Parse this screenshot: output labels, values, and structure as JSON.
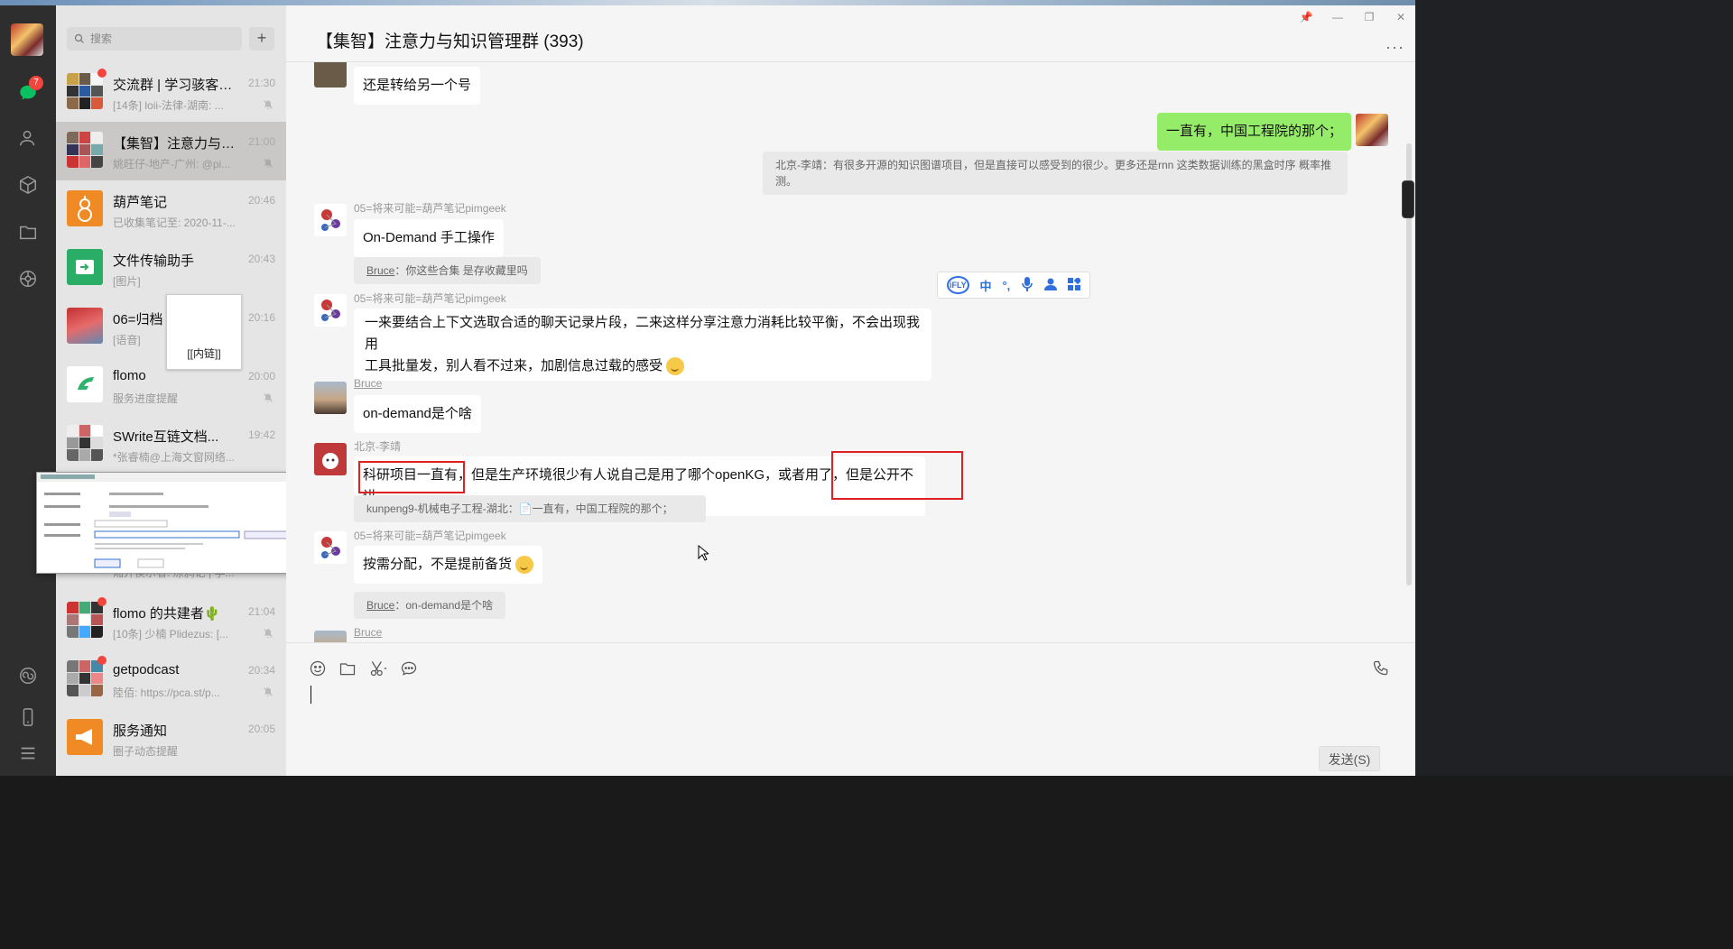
{
  "rail": {
    "unread_badge": "7",
    "icons": [
      "chat-icon",
      "contacts-icon",
      "favorites-icon",
      "files-icon",
      "moments-icon",
      "mini-program-icon",
      "phone-icon",
      "menu-icon"
    ]
  },
  "search": {
    "placeholder": "搜索",
    "add_label": "+"
  },
  "conversations": [
    {
      "name": "交流群 | 学习骇客20...",
      "time": "21:30",
      "preview": "[14条] loii-法律-湖南: ...",
      "muted": true,
      "unread": true
    },
    {
      "name": "【集智】注意力与知...",
      "time": "21:00",
      "preview": "姚旺仔-地产-广州: @pi...",
      "muted": true,
      "active": true
    },
    {
      "name": "葫芦笔记",
      "time": "20:46",
      "preview": "已收集笔记至: 2020-11-...",
      "muted": false
    },
    {
      "name": "文件传输助手",
      "time": "20:43",
      "preview": "[图片]",
      "muted": false
    },
    {
      "name": "06=归档",
      "time": "20:16",
      "preview": "[语音]",
      "muted": false
    },
    {
      "name": "flomo",
      "time": "20:00",
      "preview": "服务进度提醒",
      "muted": true
    },
    {
      "name": "SWrite互链文档...",
      "time": "19:42",
      "preview": "*张睿楠@上海文窗网络...",
      "muted": false
    },
    {
      "name": "",
      "time": "",
      "preview": "湘开侯示者: 冻鸦记 | 学...",
      "muted": false
    },
    {
      "name": "flomo 的共建者🌵",
      "time": "21:04",
      "preview": "[10条] 少楠 Plidezus: [...",
      "muted": true,
      "unread": true
    },
    {
      "name": "getpodcast",
      "time": "20:34",
      "preview": "陸佰: https://pca.st/p...",
      "muted": true,
      "unread": true
    },
    {
      "name": "服务通知",
      "time": "20:05",
      "preview": "圈子动态提醒",
      "muted": false
    }
  ],
  "popup": {
    "inner_link": "[[内链]]"
  },
  "chat": {
    "title": "【集智】注意力与知识管理群 (393)",
    "more": "···",
    "window_controls": [
      "📌",
      "—",
      "❐",
      "✕"
    ]
  },
  "messages": {
    "m1": "还是转给另一个号",
    "m2_me": "一直有，中国工程院的那个；",
    "m2_quote": "北京-李靖：有很多开源的知识图谱项目，但是直接可以感受到的很少。更多还是rnn 这类数据训练的黑盒时序 概率推测。",
    "m3_sender": "05=将来可能=葫芦笔记pimgeek",
    "m3": "On-Demand 手工操作",
    "m3_quote_user": "Bruce",
    "m3_quote_text": "：你这些合集 是存收藏里吗",
    "m4_sender": "05=将来可能=葫芦笔记pimgeek",
    "m4_line1": "一来要结合上下文选取合适的聊天记录片段，二来这样分享注意力消耗比较平衡，不会出现我用",
    "m4_line2": "工具批量发，别人看不过来，加剧信息过载的感受",
    "m5_sender": "Bruce",
    "m5": "on-demand是个啥",
    "m6_sender": "北京-李靖",
    "m6": "科研项目一直有，但是生产环境很少有人说自己是用了哪个openKG，或者用了，但是公开不讲",
    "m6_quote": "kunpeng9-机械电子工程-湖北：📄一直有，中国工程院的那个；",
    "m7_sender": "05=将来可能=葫芦笔记pimgeek",
    "m7": "按需分配，不是提前备货",
    "m7_quote_user": "Bruce",
    "m7_quote_text": "：on-demand是个啥",
    "m8_sender": "Bruce"
  },
  "ime": {
    "items": [
      "iFLY",
      "中",
      "°,",
      "🎤",
      "👤",
      "▦"
    ]
  },
  "input": {
    "send_label": "发送(S)"
  },
  "colors": {
    "accent_green": "#95ec69",
    "badge_red": "#f2453d",
    "highlight_red": "#e02020"
  }
}
